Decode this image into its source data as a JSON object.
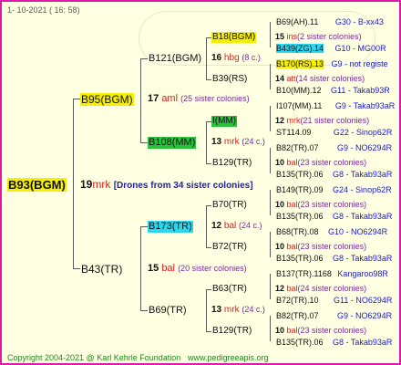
{
  "header": {
    "date": "1- 10-2021 ( 16: 58)"
  },
  "footer": {
    "copyright": "Copyright 2004-2021 @ Karl Kehrle Foundation",
    "link": "www.pedigreeapis.org"
  },
  "root": {
    "name": "B93(BGM)",
    "num": "19",
    "mark": "mrk",
    "note": "[Drones from 34 sister colonies]"
  },
  "level1": [
    {
      "name": "B95(BGM)",
      "num": "17",
      "mark": "aml",
      "sis": "(25 sister colonies)"
    },
    {
      "name": "B43(TR)",
      "num": "15",
      "mark": "bal",
      "sis": "(20 sister colonies)"
    }
  ],
  "level2": [
    {
      "name": "B121(BGM)",
      "num": "16",
      "mark": "hbg",
      "sis": "(8 c.)"
    },
    {
      "name": "B108(MM)",
      "num": "13",
      "mark": "mrk",
      "sis": "(24 c.)"
    },
    {
      "name": "B173(TR)",
      "num": "12",
      "mark": "bal",
      "sis": "(24 c.)"
    },
    {
      "name": "B69(TR)",
      "num": "13",
      "mark": "mrk",
      "sis": "(24 c.)"
    }
  ],
  "level3": [
    {
      "name": "B18(BGM)"
    },
    {
      "name": "B39(RS)"
    },
    {
      "name": "I(MM)"
    },
    {
      "name": "B129(TR)"
    },
    {
      "name": "B70(TR)"
    },
    {
      "name": "B72(TR)"
    },
    {
      "name": "B63(TR)"
    },
    {
      "name": "B129(TR)"
    }
  ],
  "level3_info": [
    {
      "num": "15",
      "mark": "ins",
      "sis": "(2 sister colonies)"
    },
    {
      "num": "14",
      "mark": "att",
      "sis": "(14 sister colonies)"
    },
    {
      "num": "12",
      "mark": "mrk",
      "sis": "(21 sister colonies)"
    },
    {
      "num": "10",
      "mark": "bal",
      "sis": "(23 sister colonies)"
    },
    {
      "num": "10",
      "mark": "bal",
      "sis": "(23 sister colonies)"
    },
    {
      "num": "10",
      "mark": "bal",
      "sis": "(23 sister colonies)"
    },
    {
      "num": "12",
      "mark": "bal",
      "sis": "(24 sister colonies)"
    },
    {
      "num": "10",
      "mark": "bal",
      "sis": "(23 sister colonies)"
    }
  ],
  "level4": [
    {
      "name": "B69(AH).11",
      "ref": "G30 - B-xx43"
    },
    {
      "name": "B439(ZG).14",
      "ref": "G10 - MG00R"
    },
    {
      "name": "B170(RS).13",
      "ref": "G9 - not registe"
    },
    {
      "name": "B10(MM).12",
      "ref": "G11 - Takab93R"
    },
    {
      "name": "I107(MM).11",
      "ref": "G9 - Takab93aR"
    },
    {
      "name": "ST114.09",
      "ref": "G22 - Sinop62R"
    },
    {
      "name": "B82(TR).07",
      "ref": "G9 - NO6294R"
    },
    {
      "name": "B135(TR).06",
      "ref": "G8 - Takab93aR"
    },
    {
      "name": "B149(TR).09",
      "ref": "G24 - Sinop62R"
    },
    {
      "name": "B135(TR).06",
      "ref": "G8 - Takab93aR"
    },
    {
      "name": "B68(TR).08",
      "ref": "G10 - NO6294R"
    },
    {
      "name": "B135(TR).06",
      "ref": "G8 - Takab93aR"
    },
    {
      "name": "B137(TR).1168",
      "ref": "Kangaroo98R"
    },
    {
      "name": "B72(TR).10",
      "ref": "G11 - NO6294R"
    },
    {
      "name": "B82(TR).07",
      "ref": "G9 - NO6294R"
    },
    {
      "name": "B135(TR).06",
      "ref": "G8 - Takab93aR"
    }
  ]
}
